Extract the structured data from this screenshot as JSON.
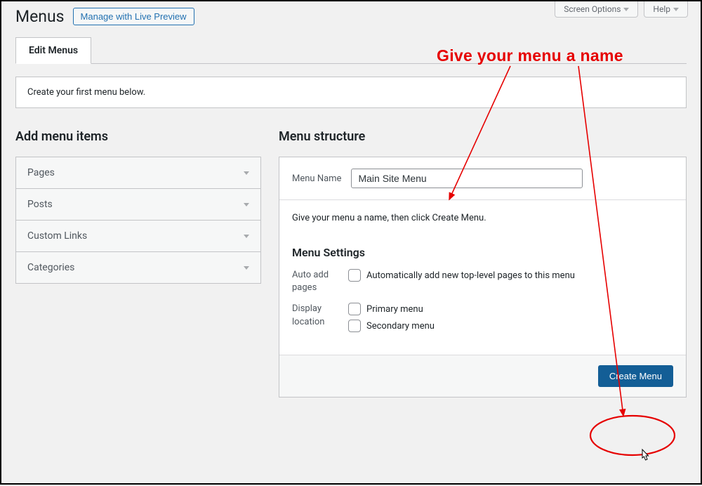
{
  "annotation": {
    "text": "Give your menu a name"
  },
  "top": {
    "screen_options": "Screen Options",
    "help": "Help"
  },
  "header": {
    "title": "Menus",
    "live_preview_btn": "Manage with Live Preview"
  },
  "tabs": {
    "edit": "Edit Menus"
  },
  "notice": {
    "text": "Create your first menu below."
  },
  "left": {
    "heading": "Add menu items",
    "items": [
      "Pages",
      "Posts",
      "Custom Links",
      "Categories"
    ]
  },
  "right": {
    "heading": "Menu structure",
    "menu_name_label": "Menu Name",
    "menu_name_value": "Main Site Menu",
    "instruction": "Give your menu a name, then click Create Menu.",
    "settings_title": "Menu Settings",
    "auto_add_label": "Auto add pages",
    "auto_add_option": "Automatically add new top-level pages to this menu",
    "display_label": "Display location",
    "display_options": [
      "Primary menu",
      "Secondary menu"
    ],
    "create_btn": "Create Menu"
  }
}
